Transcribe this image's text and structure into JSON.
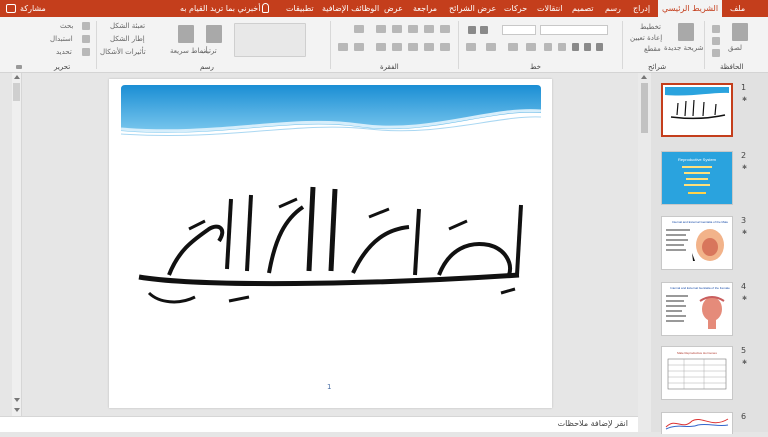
{
  "ribbon_tabs": {
    "file": "ملف",
    "home": "الشريط الرئيسي",
    "insert": "إدراج",
    "draw": "رسم",
    "design": "تصميم",
    "transitions": "انتقالات",
    "animations": "حركات",
    "slideshow": "عرض الشرائح",
    "review": "مراجعة",
    "view": "عرض",
    "addins": "الوظائف الإضافية",
    "apps": "تطبيقات",
    "tell_me": "أخبرني بما تريد القيام به",
    "share": "مشاركة"
  },
  "ribbon_groups": {
    "clipboard": "الحافظة",
    "slides": "شرائح",
    "font": "خط",
    "paragraph": "الفقرة",
    "drawing": "رسم",
    "editing": "تحرير"
  },
  "ribbon_items": {
    "paste": "لصق",
    "new_slide": "شريحة جديدة",
    "layout": "تخطيط",
    "reset": "إعادة تعيين",
    "section": "مقطع",
    "arrange": "ترتيب",
    "quick_styles": "أنماط سريعة",
    "shape_fill": "تعبئة الشكل",
    "shape_outline": "إطار الشكل",
    "shape_effects": "تأثيرات الأشكال",
    "find": "بحث",
    "replace": "استبدال",
    "select": "تحديد"
  },
  "slide": {
    "page_number": "1"
  },
  "notes": {
    "placeholder": "انقر لإضافة ملاحظات"
  },
  "thumbnails": [
    {
      "num": "1",
      "title": ""
    },
    {
      "num": "2",
      "title": "Reproductive System"
    },
    {
      "num": "3",
      "title": "Internal and External Genitalia of the Male"
    },
    {
      "num": "4",
      "title": "Internal and External Genitalia of the Female"
    },
    {
      "num": "5",
      "title": "Male Reproductive Hormones"
    },
    {
      "num": "6",
      "title": ""
    }
  ],
  "colors": {
    "accent": "#c43e1c",
    "slide_banner": "#2aa3de"
  }
}
